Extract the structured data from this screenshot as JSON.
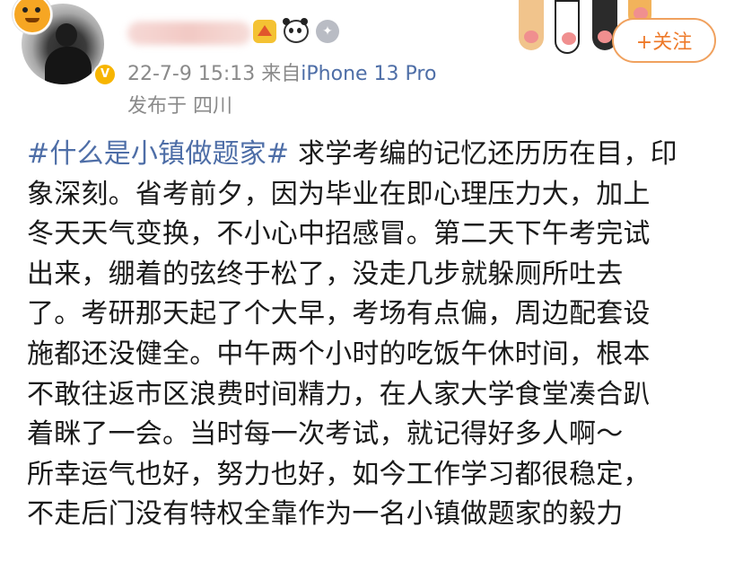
{
  "post": {
    "timestamp": "22-7-9 15:13",
    "source_prefix": "来自",
    "device": "iPhone 13 Pro",
    "location": "发布于 四川",
    "follow_label": "+关注",
    "hashtag": "#什么是小镇做题家#",
    "body_lines": [
      " 求学考编的记忆还历历在目，印",
      "象深刻。省考前夕，因为毕业在即心理压力大，加上",
      "冬天天气变换，不小心中招感冒。第二天下午考完试",
      "出来，绷着的弦终于松了，没走几步就躲厕所吐去",
      "了。考研那天起了个大早，考场有点偏，周边配套设",
      "施都还没健全。中午两个小时的吃饭午休时间，根本",
      "不敢往返市区浪费时间精力，在人家大学食堂凑合趴",
      "着眯了一会。当时每一次考试，就记得好多人啊～",
      "所幸运气也好，努力也好，如今工作学习都很稳定，",
      "不走后门没有特权全靠作为一名小镇做题家的毅力"
    ]
  },
  "icons": {
    "avatar": "user-avatar",
    "tiger": "tiger-badge-icon",
    "verified": "verified-v-icon",
    "badges": [
      "crown-badge-icon",
      "panda-badge-icon",
      "medal-badge-icon"
    ],
    "decoration": "cat-paws-icon"
  },
  "colors": {
    "link": "#4e6ea7",
    "meta": "#8a8a8a",
    "follow": "#ee7a2a",
    "text": "#1a1a1a"
  }
}
